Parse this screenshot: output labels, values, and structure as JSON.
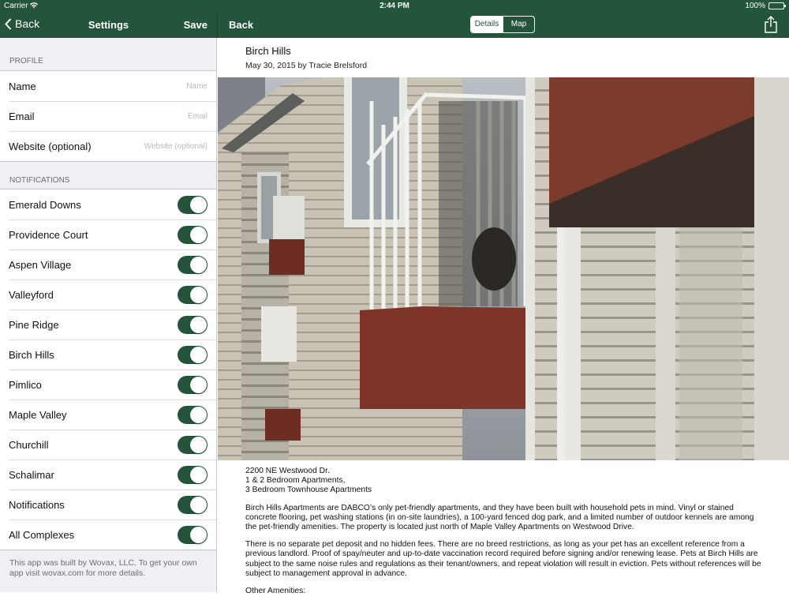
{
  "status_bar": {
    "carrier": "Carrier",
    "time": "2:44 PM",
    "battery": "100%"
  },
  "sidebar": {
    "back_label": "Back",
    "title": "Settings",
    "save_label": "Save",
    "profile_header": "PROFILE",
    "profile_fields": [
      {
        "label": "Name",
        "placeholder": "Name"
      },
      {
        "label": "Email",
        "placeholder": "Email"
      },
      {
        "label": "Website (optional)",
        "placeholder": "Website (optional)"
      }
    ],
    "notifications_header": "NOTIFICATIONS",
    "notifications": [
      {
        "label": "Emerald Downs",
        "on": true
      },
      {
        "label": "Providence Court",
        "on": true
      },
      {
        "label": "Aspen Village",
        "on": true
      },
      {
        "label": "Valleyford",
        "on": true
      },
      {
        "label": "Pine Ridge",
        "on": true
      },
      {
        "label": "Birch Hills",
        "on": true
      },
      {
        "label": "Pimlico",
        "on": true
      },
      {
        "label": "Maple Valley",
        "on": true
      },
      {
        "label": "Churchill",
        "on": true
      },
      {
        "label": "Schalimar",
        "on": true
      },
      {
        "label": "Notifications",
        "on": true
      },
      {
        "label": "All Complexes",
        "on": true
      }
    ],
    "footer": "This app was built by Wovax, LLC. To get your own app visit wovax.com for more details."
  },
  "detail": {
    "back_label": "Back",
    "tabs": [
      "Details",
      "Map"
    ],
    "active_tab": "Details",
    "title": "Birch Hills",
    "byline": "May 30, 2015 by Tracie Brelsford",
    "address_lines": [
      "2200 NE Westwood Dr.",
      "1 & 2 Bedroom Apartments,",
      "3 Bedroom Townhouse Apartments"
    ],
    "paragraphs": [
      "Birch Hills Apartments are DABCO’s only pet-friendly apartments, and they have been built with household pets in mind.  Vinyl or stained concrete flooring, pet washing stations (in on-site laundries), a 100-yard fenced dog park, and a limited number of outdoor kennels are among the pet-friendly amenities. The property is located just north of Maple Valley Apartments on Westwood Drive.",
      "There is no separate pet deposit and no hidden fees.  There are no breed restrictions, as long as your pet has an excellent reference from a previous landlord.  Proof of spay/neuter and up-to-date vaccination record required before signing and/or renewing lease.  Pets at Birch Hills are subject to the same noise rules and regulations as their tenant/owners, and repeat violation will result in eviction.  Pets without references will be subject to management approval in advance.",
      "Other Amenities:"
    ]
  },
  "colors": {
    "brand": "#24553b",
    "group_bg": "#efeff4"
  }
}
